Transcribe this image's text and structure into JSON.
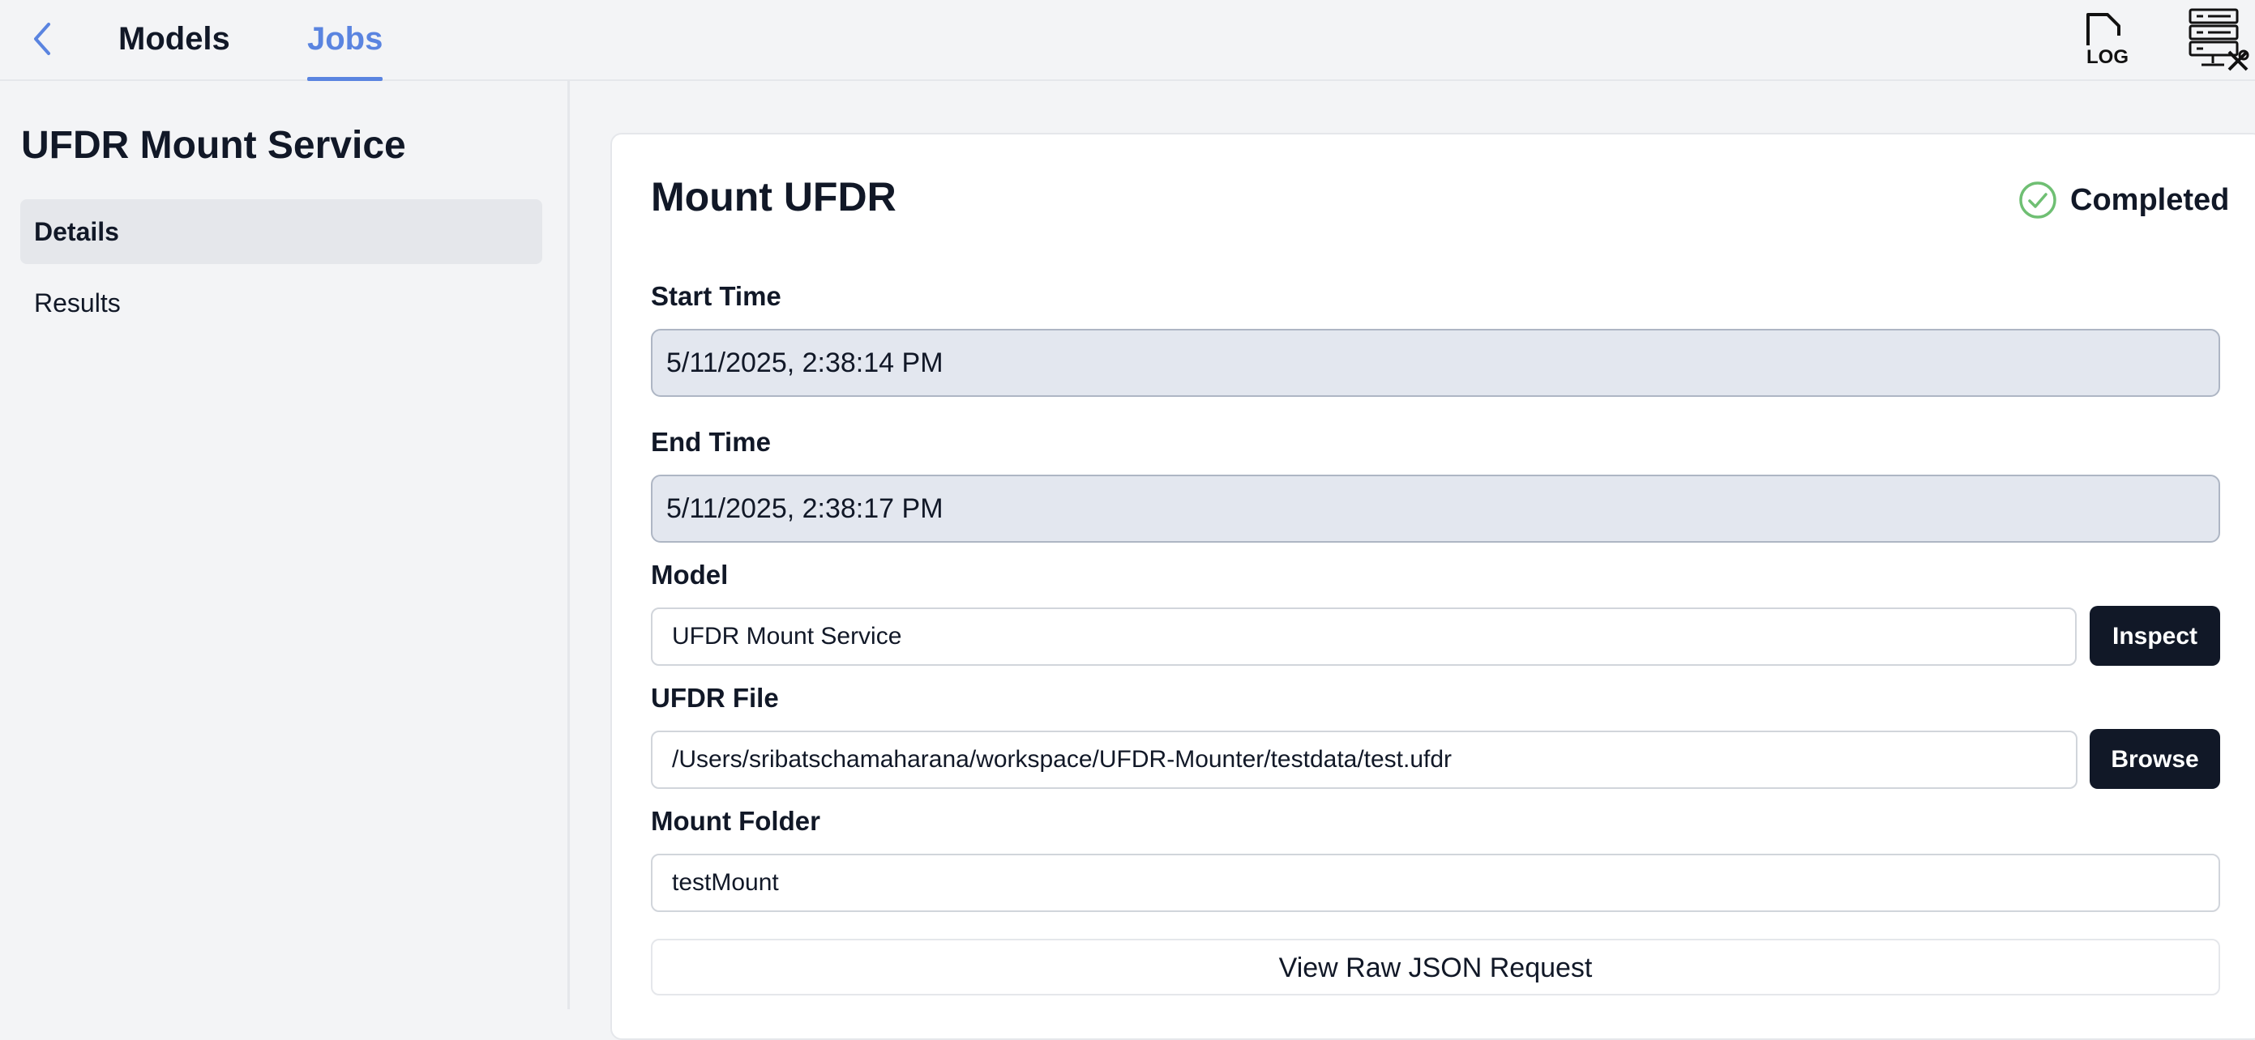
{
  "header": {
    "tabs": [
      {
        "label": "Models",
        "active": false
      },
      {
        "label": "Jobs",
        "active": true
      }
    ],
    "log_icon_text": "LOG",
    "accent_color": "#5a84e0"
  },
  "sidebar": {
    "title": "UFDR Mount Service",
    "items": [
      {
        "label": "Details",
        "active": true
      },
      {
        "label": "Results",
        "active": false
      }
    ]
  },
  "job": {
    "title": "Mount UFDR",
    "status": "Completed",
    "status_color": "#6fbf73",
    "start_time_label": "Start Time",
    "start_time": "5/11/2025, 2:38:14 PM",
    "end_time_label": "End Time",
    "end_time": "5/11/2025, 2:38:17 PM",
    "model_label": "Model",
    "model_value": "UFDR Mount Service",
    "inspect_label": "Inspect",
    "ufdr_file_label": "UFDR File",
    "ufdr_file_value": "/Users/sribatschamaharana/workspace/UFDR-Mounter/testdata/test.ufdr",
    "browse_label": "Browse",
    "mount_folder_label": "Mount Folder",
    "mount_folder_value": "testMount",
    "raw_json_label": "View Raw JSON Request"
  },
  "icons": [
    "back-chevron-icon",
    "log-file-icon",
    "server-tools-icon",
    "check-circle-icon"
  ]
}
